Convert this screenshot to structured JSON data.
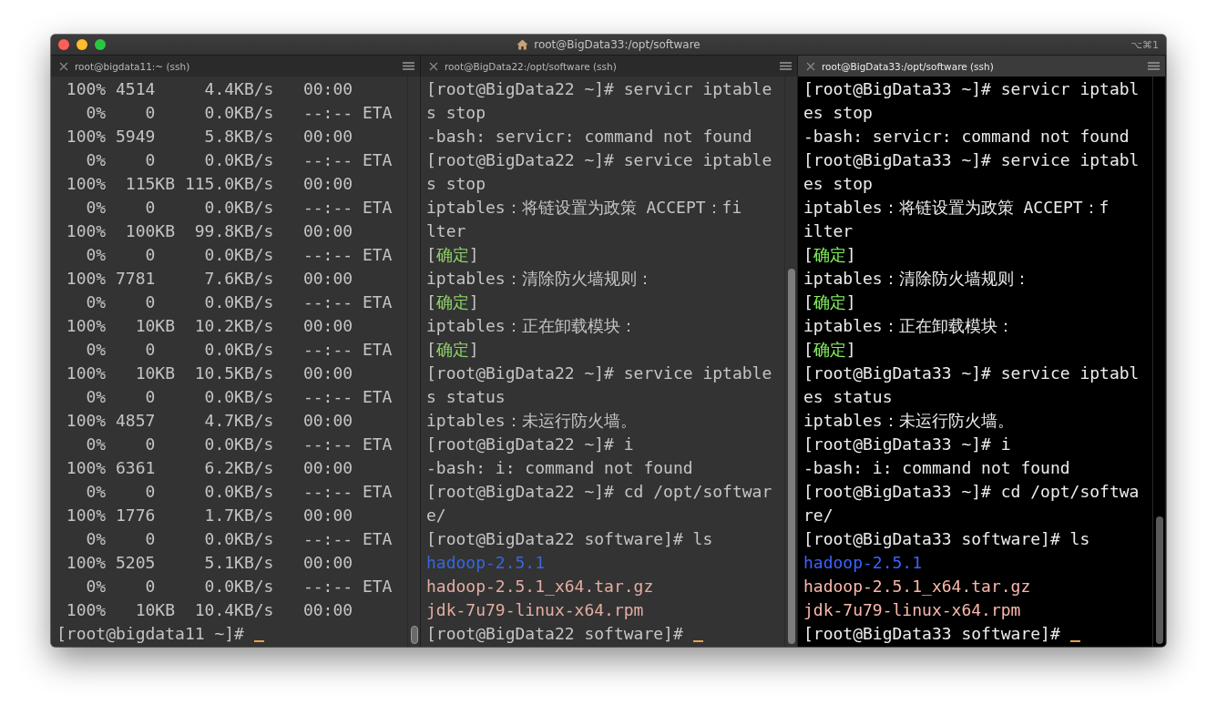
{
  "window": {
    "title": "root@BigData33:/opt/software",
    "shortcut": "⌥⌘1"
  },
  "panes": [
    {
      "tab": {
        "label": "root@bigdata11:~ (ssh)",
        "selected": false
      },
      "rows": [
        {
          "text": " 100% 4514     4.4KB/s   00:00"
        },
        {
          "text": "   0%    0     0.0KB/s   --:-- ETA"
        },
        {
          "text": " 100% 5949     5.8KB/s   00:00"
        },
        {
          "text": "   0%    0     0.0KB/s   --:-- ETA"
        },
        {
          "text": " 100%  115KB 115.0KB/s   00:00"
        },
        {
          "text": "   0%    0     0.0KB/s   --:-- ETA"
        },
        {
          "text": " 100%  100KB  99.8KB/s   00:00"
        },
        {
          "text": "   0%    0     0.0KB/s   --:-- ETA"
        },
        {
          "text": " 100% 7781     7.6KB/s   00:00"
        },
        {
          "text": "   0%    0     0.0KB/s   --:-- ETA"
        },
        {
          "text": " 100%   10KB  10.2KB/s   00:00"
        },
        {
          "text": "   0%    0     0.0KB/s   --:-- ETA"
        },
        {
          "text": " 100%   10KB  10.5KB/s   00:00"
        },
        {
          "text": "   0%    0     0.0KB/s   --:-- ETA"
        },
        {
          "text": " 100% 4857     4.7KB/s   00:00"
        },
        {
          "text": "   0%    0     0.0KB/s   --:-- ETA"
        },
        {
          "text": " 100% 6361     6.2KB/s   00:00"
        },
        {
          "text": "   0%    0     0.0KB/s   --:-- ETA"
        },
        {
          "text": " 100% 1776     1.7KB/s   00:00"
        },
        {
          "text": "   0%    0     0.0KB/s   --:-- ETA"
        },
        {
          "text": " 100% 5205     5.1KB/s   00:00"
        },
        {
          "text": "   0%    0     0.0KB/s   --:-- ETA"
        },
        {
          "text": " 100%   10KB  10.4KB/s   00:00"
        },
        {
          "text": "[root@bigdata11 ~]# ",
          "cursor": true
        }
      ]
    },
    {
      "tab": {
        "label": "root@BigData22:/opt/software (ssh)",
        "selected": false
      },
      "rows": [
        {
          "text": "[root@BigData22 ~]# servicr iptable"
        },
        {
          "text": "s stop"
        },
        {
          "text": "-bash: servicr: command not found"
        },
        {
          "text": "[root@BigData22 ~]# service iptable"
        },
        {
          "text": "s stop"
        },
        {
          "text": "iptables：将链设置为政策 ACCEPT：fi"
        },
        {
          "text": "lter"
        },
        {
          "parts": [
            {
              "text": "[",
              "kind": "plain"
            },
            {
              "text": "确定",
              "kind": "ok"
            },
            {
              "text": "]",
              "kind": "plain"
            }
          ]
        },
        {
          "text": "iptables：清除防火墙规则："
        },
        {
          "parts": [
            {
              "text": "[",
              "kind": "plain"
            },
            {
              "text": "确定",
              "kind": "ok"
            },
            {
              "text": "]",
              "kind": "plain"
            }
          ]
        },
        {
          "text": "iptables：正在卸载模块："
        },
        {
          "parts": [
            {
              "text": "[",
              "kind": "plain"
            },
            {
              "text": "确定",
              "kind": "ok"
            },
            {
              "text": "]",
              "kind": "plain"
            }
          ]
        },
        {
          "text": "[root@BigData22 ~]# service iptable"
        },
        {
          "text": "s status"
        },
        {
          "text": "iptables：未运行防火墙。"
        },
        {
          "text": "[root@BigData22 ~]# i"
        },
        {
          "text": "-bash: i: command not found"
        },
        {
          "text": "[root@BigData22 ~]# cd /opt/softwar"
        },
        {
          "text": "e/"
        },
        {
          "text": "[root@BigData22 software]# ls"
        },
        {
          "text": "hadoop-2.5.1",
          "kind": "dir"
        },
        {
          "text": "hadoop-2.5.1_x64.tar.gz",
          "kind": "archive"
        },
        {
          "text": "jdk-7u79-linux-x64.rpm",
          "kind": "archive"
        },
        {
          "text": "[root@BigData22 software]# ",
          "cursor": true
        }
      ]
    },
    {
      "tab": {
        "label": "root@BigData33:/opt/software (ssh)",
        "selected": true
      },
      "rows": [
        {
          "text": "[root@BigData33 ~]# servicr iptabl"
        },
        {
          "text": "es stop"
        },
        {
          "text": "-bash: servicr: command not found"
        },
        {
          "text": "[root@BigData33 ~]# service iptabl"
        },
        {
          "text": "es stop"
        },
        {
          "text": "iptables：将链设置为政策 ACCEPT：f"
        },
        {
          "text": "ilter"
        },
        {
          "parts": [
            {
              "text": "[",
              "kind": "plain"
            },
            {
              "text": "确定",
              "kind": "ok"
            },
            {
              "text": "]",
              "kind": "plain"
            }
          ]
        },
        {
          "text": "iptables：清除防火墙规则："
        },
        {
          "parts": [
            {
              "text": "[",
              "kind": "plain"
            },
            {
              "text": "确定",
              "kind": "ok"
            },
            {
              "text": "]",
              "kind": "plain"
            }
          ]
        },
        {
          "text": "iptables：正在卸载模块："
        },
        {
          "parts": [
            {
              "text": "[",
              "kind": "plain"
            },
            {
              "text": "确定",
              "kind": "ok"
            },
            {
              "text": "]",
              "kind": "plain"
            }
          ]
        },
        {
          "text": "[root@BigData33 ~]# service iptabl"
        },
        {
          "text": "es status"
        },
        {
          "text": "iptables：未运行防火墙。"
        },
        {
          "text": "[root@BigData33 ~]# i"
        },
        {
          "text": "-bash: i: command not found"
        },
        {
          "text": "[root@BigData33 ~]# cd /opt/softwa"
        },
        {
          "text": "re/"
        },
        {
          "text": "[root@BigData33 software]# ls"
        },
        {
          "text": "hadoop-2.5.1",
          "kind": "dir"
        },
        {
          "text": "hadoop-2.5.1_x64.tar.gz",
          "kind": "archive"
        },
        {
          "text": "jdk-7u79-linux-x64.rpm",
          "kind": "archive"
        },
        {
          "text": "[root@BigData33 software]# ",
          "cursor": true
        }
      ]
    }
  ]
}
